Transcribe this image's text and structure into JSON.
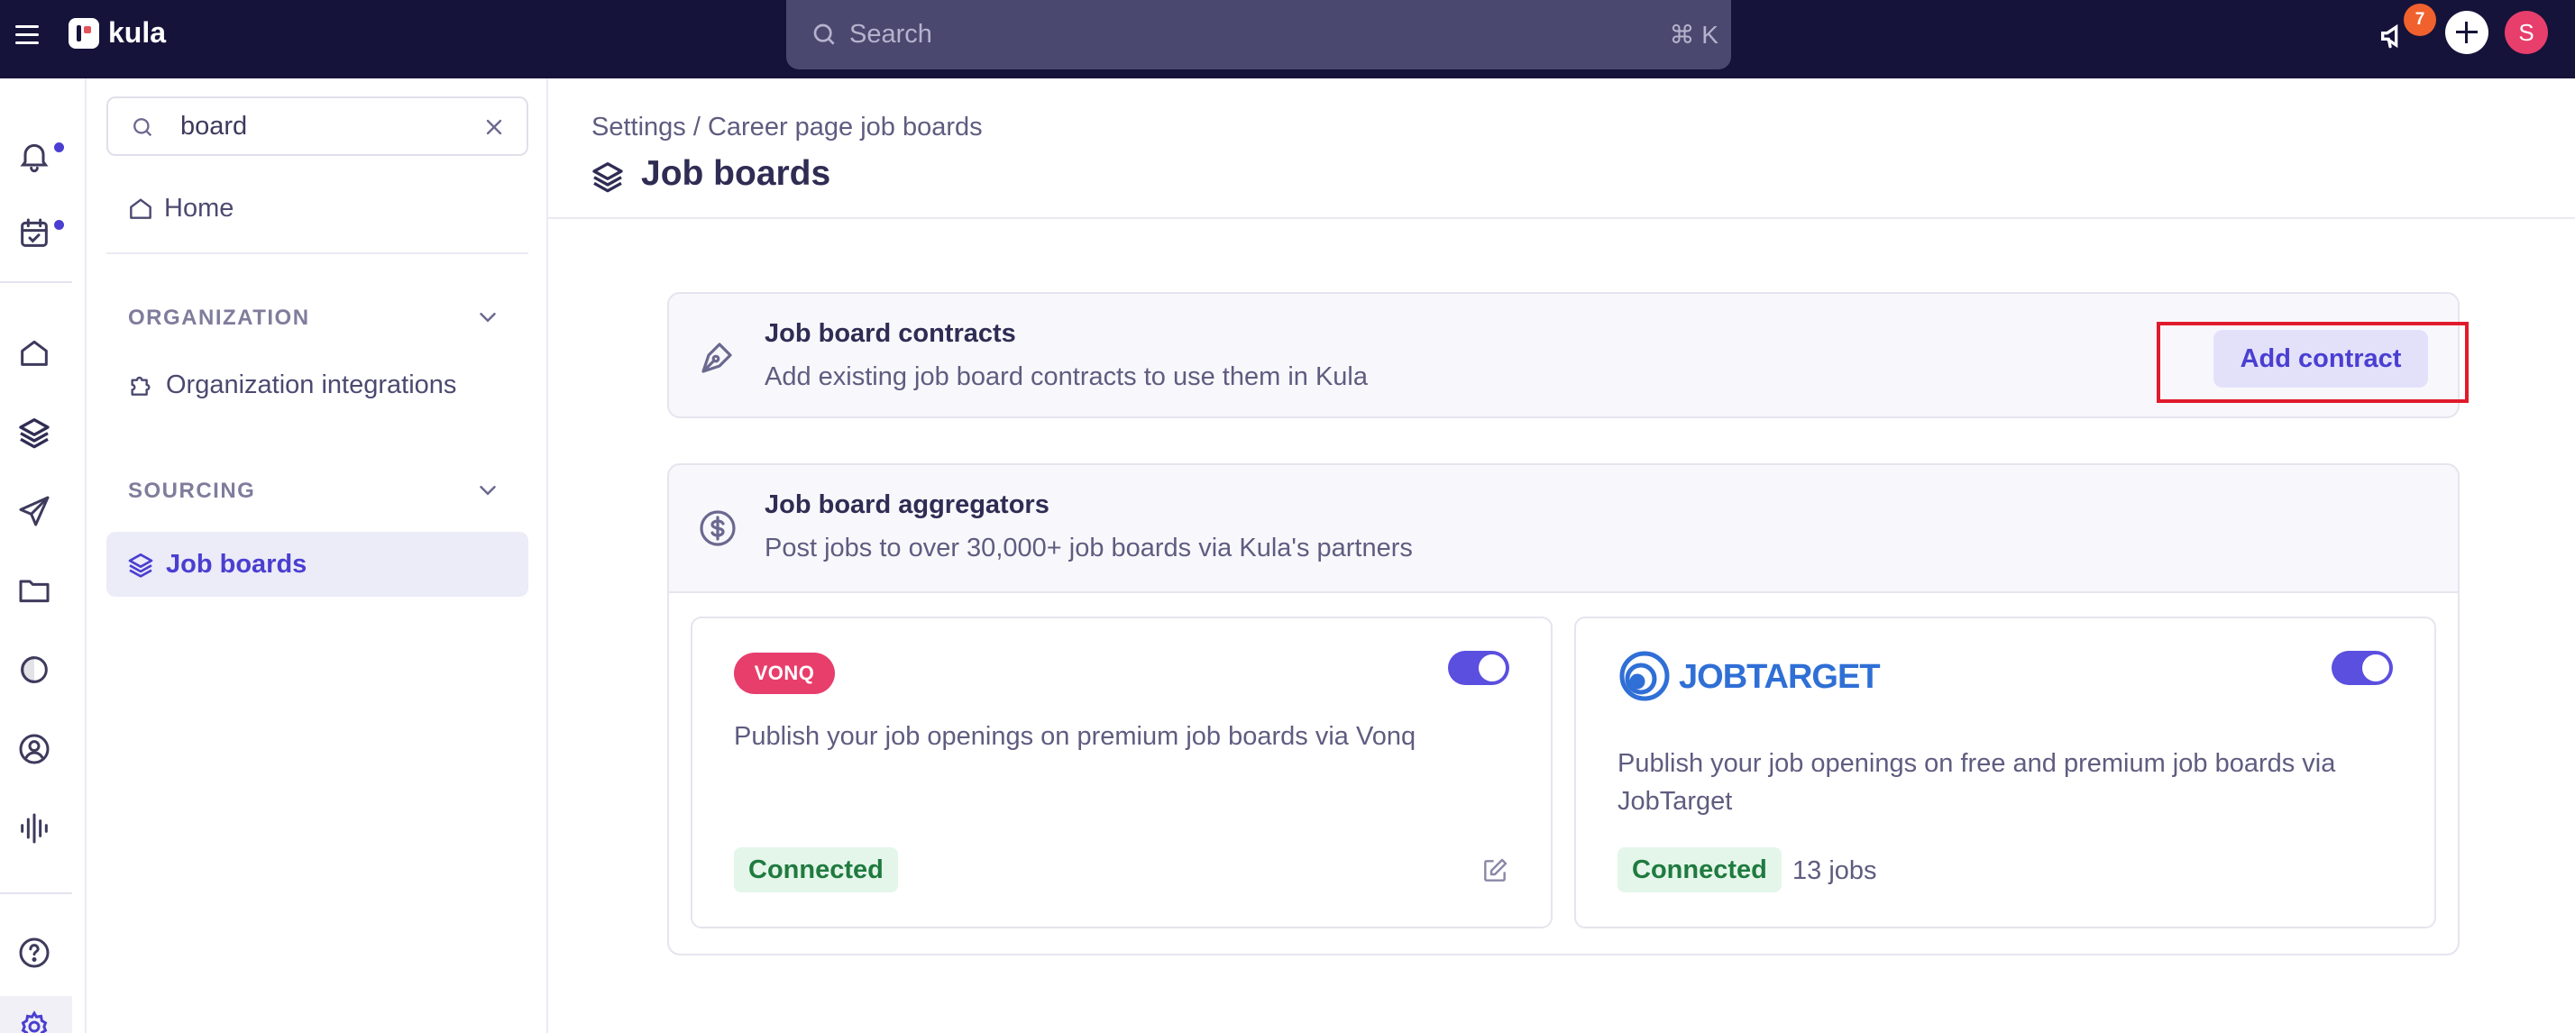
{
  "topbar": {
    "brand": "kula",
    "search_placeholder": "Search",
    "search_shortcut": "⌘ K",
    "notification_count": "7",
    "avatar_initial": "S"
  },
  "sidebar": {
    "search_value": "board",
    "home_label": "Home",
    "sections": [
      {
        "title": "ORGANIZATION",
        "items": [
          {
            "label": "Organization integrations"
          }
        ]
      },
      {
        "title": "SOURCING",
        "items": [
          {
            "label": "Job boards"
          }
        ]
      }
    ]
  },
  "main": {
    "breadcrumb": "Settings / Career page job boards",
    "title": "Job boards",
    "contracts": {
      "title": "Job board contracts",
      "description": "Add existing job board contracts to use them in Kula",
      "button_label": "Add contract"
    },
    "aggregators": {
      "title": "Job board aggregators",
      "description": "Post jobs to over 30,000+ job boards via Kula's partners",
      "providers": [
        {
          "logo_text": "VONQ",
          "description": "Publish your job openings on premium job boards via Vonq",
          "status": "Connected",
          "jobs": "",
          "enabled": true
        },
        {
          "logo_text": "JOBTARGET",
          "description": "Publish your job openings on free and premium job boards via JobTarget",
          "status": "Connected",
          "jobs": "13 jobs",
          "enabled": true
        }
      ]
    }
  },
  "colors": {
    "topbar": "#15133a",
    "accent": "#4a3fd1",
    "toggle": "#5b4fe0",
    "vonq": "#e83e6c",
    "jobtarget": "#2f6fd6",
    "connected_bg": "#e4f6ea",
    "connected_text": "#1f7a3e",
    "highlight": "#e01b2b"
  },
  "icons": {
    "rail": [
      "bell-icon",
      "calendar-check-icon",
      "home-icon",
      "layers-icon",
      "send-icon",
      "folder-icon",
      "half-circle-icon",
      "user-circle-icon",
      "audio-bars-icon",
      "help-icon",
      "settings-icon"
    ]
  }
}
